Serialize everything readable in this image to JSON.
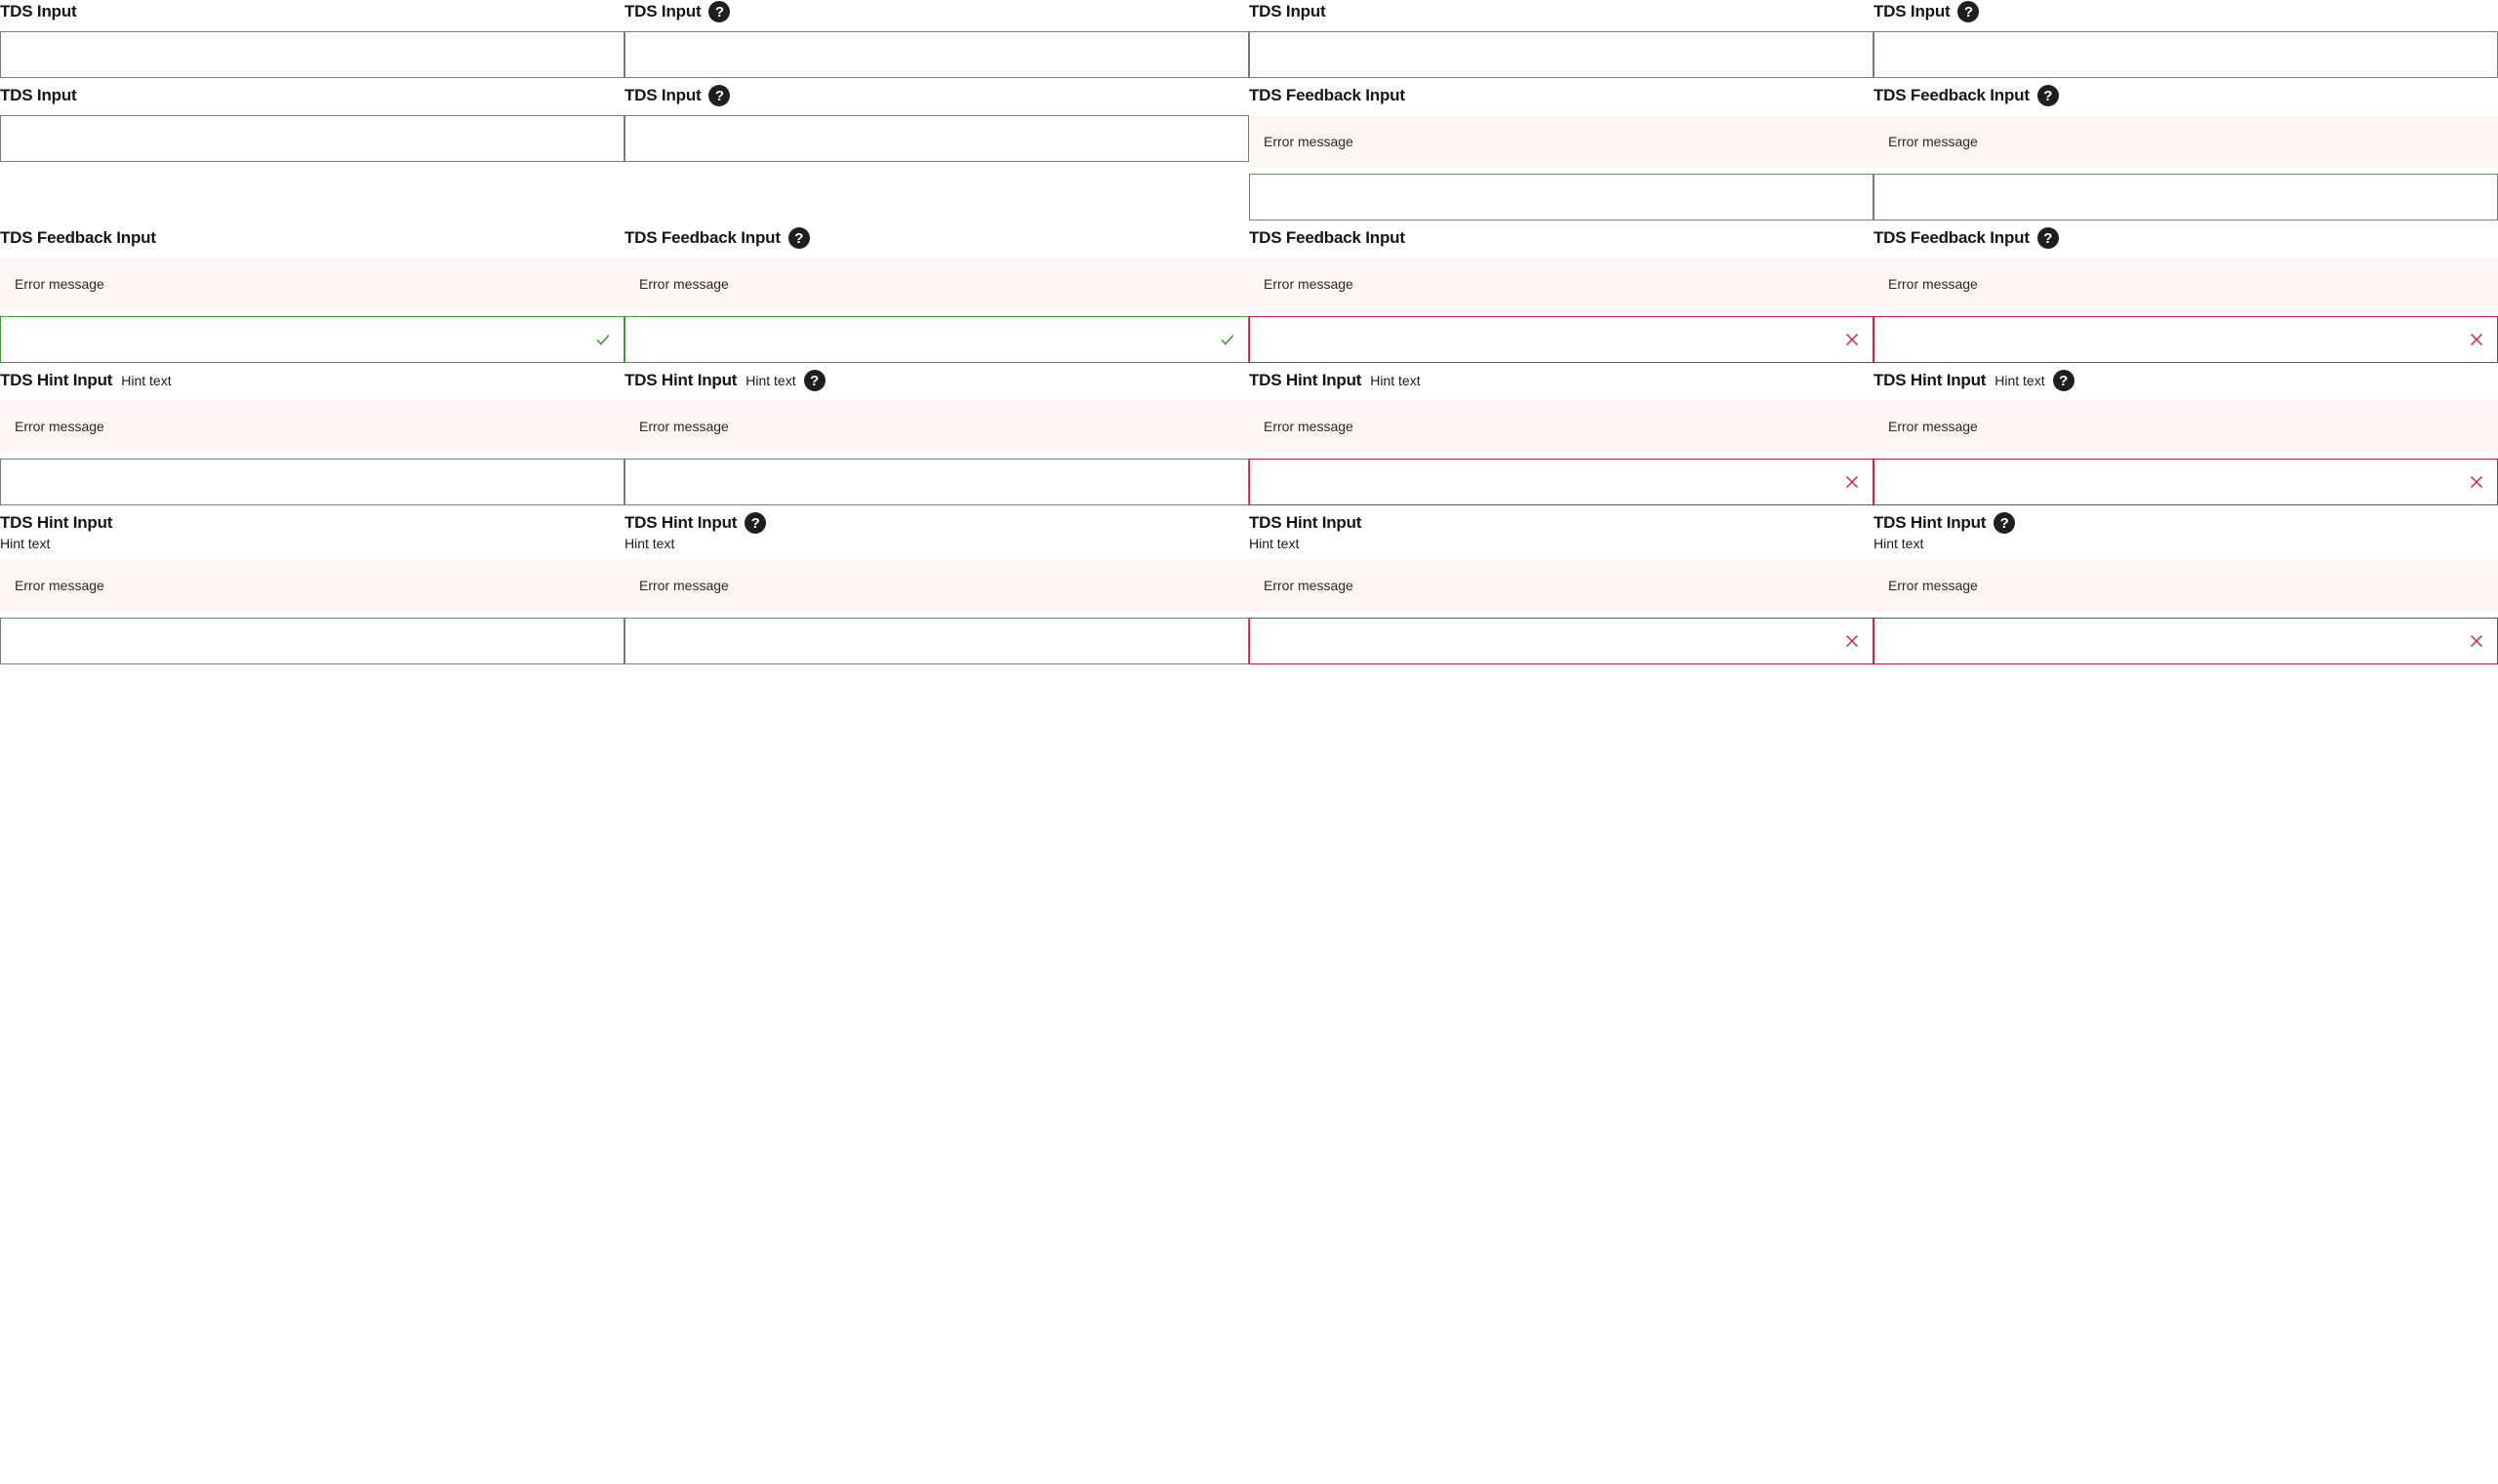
{
  "colors": {
    "success": "#3f9c35",
    "error": "#d3203b",
    "feedback_bg": "#fdf4f4",
    "border": "#7a7a7a"
  },
  "icons": {
    "help": "question-mark-circle-icon",
    "success": "checkmark-icon",
    "error": "close-x-icon"
  },
  "help_glyph": "?",
  "rows": [
    {
      "cells": [
        {
          "label": "TDS Input"
        },
        {
          "label": "TDS Input"
        },
        {
          "label": "TDS Input"
        },
        {
          "label": "TDS Input"
        }
      ]
    },
    {
      "cells": [
        {
          "label": "TDS Input"
        },
        {
          "label": "TDS Input"
        },
        {
          "label": "TDS Feedback Input",
          "feedback": "Error message"
        },
        {
          "label": "TDS Feedback Input",
          "feedback": "Error message"
        }
      ]
    },
    {
      "cells": [
        {
          "label": "TDS Feedback Input",
          "feedback": "Error message",
          "state": "success"
        },
        {
          "label": "TDS Feedback Input",
          "feedback": "Error message",
          "state": "success"
        },
        {
          "label": "TDS Feedback Input",
          "feedback": "Error message",
          "state": "error"
        },
        {
          "label": "TDS Feedback Input",
          "feedback": "Error message",
          "state": "error"
        }
      ]
    },
    {
      "cells": [
        {
          "label": "TDS Hint Input",
          "hint": "Hint text",
          "feedback": "Error message"
        },
        {
          "label": "TDS Hint Input",
          "hint": "Hint text",
          "feedback": "Error message"
        },
        {
          "label": "TDS Hint Input",
          "hint": "Hint text",
          "feedback": "Error message",
          "state": "error"
        },
        {
          "label": "TDS Hint Input",
          "hint": "Hint text",
          "feedback": "Error message",
          "state": "error"
        }
      ]
    },
    {
      "cells": [
        {
          "label": "TDS Hint Input",
          "hint": "Hint text",
          "feedback": "Error message"
        },
        {
          "label": "TDS Hint Input",
          "hint": "Hint text",
          "feedback": "Error message"
        },
        {
          "label": "TDS Hint Input",
          "hint": "Hint text",
          "feedback": "Error message",
          "state": "error"
        },
        {
          "label": "TDS Hint Input",
          "hint": "Hint text",
          "feedback": "Error message",
          "state": "error"
        }
      ]
    }
  ]
}
